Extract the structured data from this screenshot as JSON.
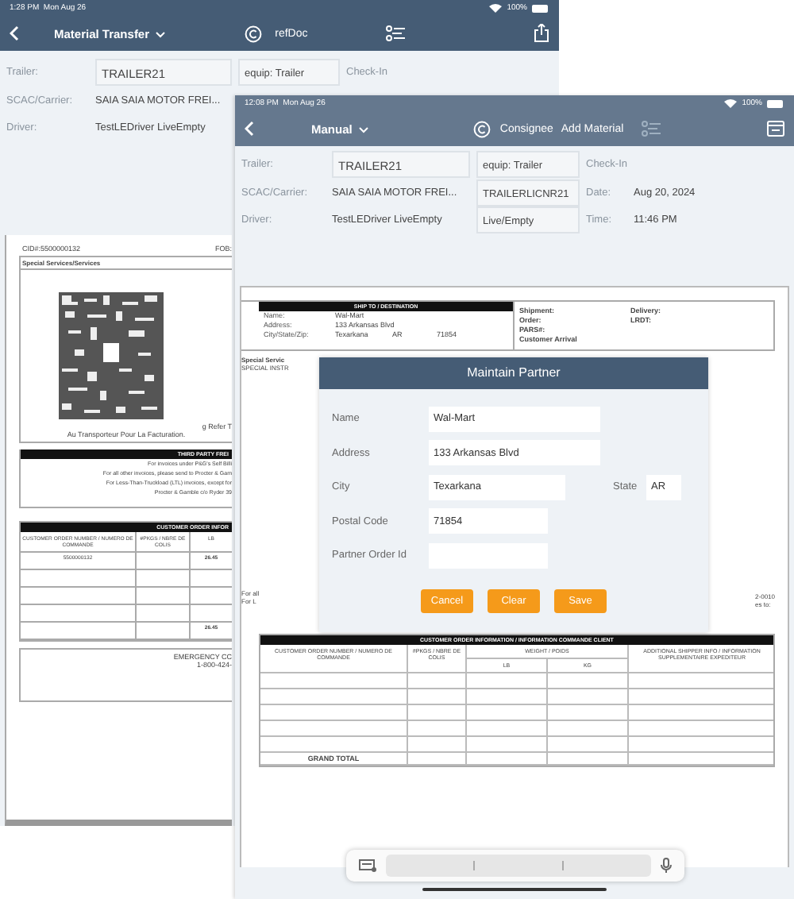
{
  "back_window": {
    "status_bar": {
      "time": "1:28 PM",
      "date": "Mon Aug 26",
      "battery": "100%"
    },
    "nav": {
      "title": "Material Transfer",
      "link": "refDoc"
    },
    "header": [
      {
        "label": "Trailer:",
        "value": "TRAILER21",
        "kind": "field",
        "extra": "equip: Trailer",
        "label2": "Check-In"
      },
      {
        "label": "SCAC/Carrier:",
        "value": "SAIA  SAIA MOTOR FREI...",
        "kind": "text"
      },
      {
        "label": "Driver:",
        "value": "TestLEDriver LiveEmpty",
        "kind": "text"
      }
    ],
    "document": {
      "cid": "CID#:5500000132",
      "fob": "FOB:",
      "special_services": "Special Services/Services",
      "notes": [
        "g Refer T",
        "Au Transporteur Pour La Facturation."
      ],
      "third_party_title": "THIRD PARTY FREI",
      "third_party_lines": [
        "For invoices under P&G's Self Billi",
        "For all other invoices, please send to Procter & Gam",
        "For Less-Than-Truckload (LTL) invoices, except for",
        "Procter & Gamble c/o Ryder 39"
      ],
      "order_table": {
        "title": "CUSTOMER ORDER INFOR",
        "columns": [
          "CUSTOMER ORDER NUMBER / NUMERO DE COMMANDE",
          "#PKGS / NBRE DE COLIS",
          "LB"
        ],
        "rows": [
          {
            "order": "5500000132",
            "lb": "26.45"
          },
          {},
          {},
          {},
          {
            "lb": "26.45"
          }
        ]
      },
      "emergency": [
        "EMERGENCY CC",
        "1-800-424-"
      ]
    }
  },
  "front_window": {
    "status_bar": {
      "time": "12:08 PM",
      "date": "Mon Aug 26",
      "battery": "100%"
    },
    "nav": {
      "title": "Manual",
      "links": [
        "Consignee",
        "Add Material"
      ]
    },
    "header": [
      {
        "label": "Trailer:",
        "value": "TRAILER21",
        "kind": "field",
        "extra": "equip: Trailer",
        "label2": "Check-In"
      },
      {
        "label": "SCAC/Carrier:",
        "value": "SAIA  SAIA MOTOR FREI...",
        "kind": "text",
        "extra": "TRAILERLICNR21",
        "label2": "Date:",
        "value2": "Aug 20, 2024"
      },
      {
        "label": "Driver:",
        "value": "TestLEDriver LiveEmpty",
        "kind": "text",
        "extra": "Live/Empty",
        "label2": "Time:",
        "value2": "11:46 PM"
      }
    ],
    "document": {
      "ship_to": {
        "title": "SHIP TO / DESTINATION",
        "fields": [
          {
            "label": "Name:",
            "value": "Wal-Mart"
          },
          {
            "label": "Address:",
            "value": "133 Arkansas Blvd"
          },
          {
            "label": "City/State/Zip:",
            "value": "Texarkana",
            "state": "AR",
            "zip": "71854"
          }
        ]
      },
      "shipment_labels": [
        "Shipment:",
        "Delivery:",
        "Order:",
        "LRDT:",
        "PARS#:",
        "Customer Arrival"
      ],
      "fragments_left": [
        "Special Servic",
        "SPECIAL INSTR",
        "For all",
        "For L"
      ],
      "fragments_right": [
        "2-0010",
        "es to:"
      ],
      "order_table": {
        "title": "CUSTOMER ORDER INFORMATION / INFORMATION COMMANDE CLIENT",
        "columns": [
          "CUSTOMER ORDER NUMBER / NUMERO DE COMMANDE",
          "#PKGS / NBRE DE COLIS",
          "WEIGHT / POIDS",
          "ADDITIONAL SHIPPER INFO / INFORMATION SUPPLEMENTAIRE EXPEDITEUR"
        ],
        "units": [
          "LB",
          "KG"
        ],
        "rows": [
          {},
          {},
          {},
          {},
          {},
          {
            "total": "GRAND TOTAL"
          }
        ]
      }
    }
  },
  "dialog": {
    "title": "Maintain Partner",
    "fields": [
      {
        "label": "Name",
        "value": "Wal-Mart",
        "kind": "wide"
      },
      {
        "label": "Address",
        "value": "133 Arkansas Blvd",
        "kind": "wide"
      },
      {
        "label": "City",
        "value": "Texarkana",
        "kind": "medium",
        "side_label": "State",
        "side_value": "AR"
      },
      {
        "label": "Postal Code",
        "value": "71854",
        "kind": "short"
      },
      {
        "label": "Partner Order Id",
        "kind": "short"
      }
    ],
    "buttons": [
      "Cancel",
      "Clear",
      "Save"
    ]
  }
}
